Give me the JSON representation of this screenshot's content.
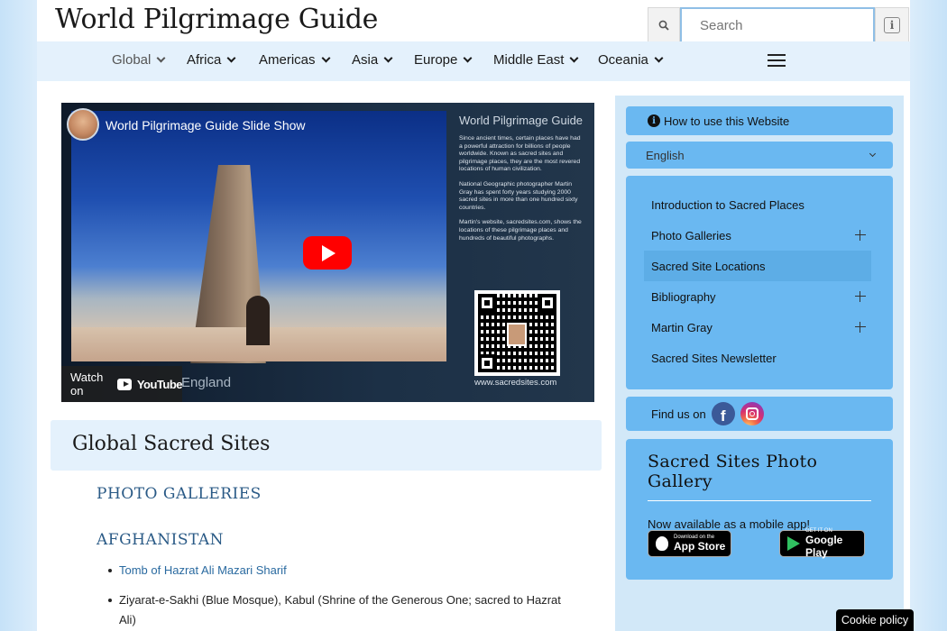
{
  "header": {
    "site_title": "World Pilgrimage Guide",
    "search_placeholder": "Search"
  },
  "nav": {
    "items": [
      {
        "label": "Global"
      },
      {
        "label": "Africa"
      },
      {
        "label": "Americas"
      },
      {
        "label": "Asia"
      },
      {
        "label": "Europe"
      },
      {
        "label": "Middle East"
      },
      {
        "label": "Oceania"
      }
    ],
    "active_item": "Global"
  },
  "video": {
    "title": "World Pilgrimage Guide Slide Show",
    "side_title": "World Pilgrimage Guide",
    "side_paragraphs": [
      "Since ancient times, certain places have had a powerful attraction for billions of people worldwide. Known as sacred sites and pilgrimage places, they are the most revered locations of human civilization.",
      "National Geographic photographer Martin Gray has spent forty years studying 2000 sacred sites in more than one hundred sixty countries.",
      "Martin's website, sacredsites.com, shows the locations of these pilgrimage places and hundreds of beautiful photographs."
    ],
    "qr_url": "www.sacredsites.com",
    "watch_on": "Watch on",
    "youtube": "YouTube",
    "caption": "England"
  },
  "main": {
    "section_title": "Global Sacred Sites",
    "photo_galleries_heading": "PHOTO GALLERIES",
    "country_heading": "AFGHANISTAN",
    "list_items": [
      "Tomb of Hazrat Ali Mazari Sharif",
      "Ziyarat-e-Sakhi (Blue Mosque), Kabul (Shrine of the Generous One; sacred to Hazrat Ali)"
    ]
  },
  "sidebar": {
    "how_to": "How to use this Website",
    "language": "English",
    "menu": [
      {
        "label": "Introduction to Sacred Places",
        "expandable": false
      },
      {
        "label": "Photo Galleries",
        "expandable": true
      },
      {
        "label": "Sacred Site Locations",
        "expandable": false,
        "active": true
      },
      {
        "label": "Bibliography",
        "expandable": true
      },
      {
        "label": "Martin Gray",
        "expandable": true
      },
      {
        "label": "Sacred Sites Newsletter",
        "expandable": false
      }
    ],
    "find_us": "Find us on",
    "gallery_title": "Sacred Sites Photo Gallery",
    "gallery_text": "Now available as a mobile app!",
    "app_store_small": "Download on the",
    "app_store_big": "App Store",
    "google_small": "GET IT ON",
    "google_big": "Google Play"
  },
  "cookie_label": "Cookie policy",
  "colors": {
    "nav_bg": "#e4f1fc",
    "sidebar_box": "#6ab8f1",
    "link": "#2a6aa0"
  }
}
